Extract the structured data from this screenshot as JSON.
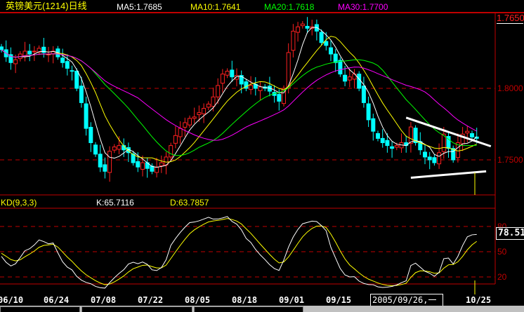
{
  "header": {
    "title": "英镑美元(1214)日线",
    "ma5": "MA5:1.7685",
    "ma10": "MA10:1.7641",
    "ma20": "MA20:1.7618",
    "ma30": "MA30:1.7700"
  },
  "price_axis": {
    "labels": [
      "1.8000",
      "1.7500"
    ],
    "cursor_value": "1.7650"
  },
  "kd": {
    "title": "KD(9,3,3)",
    "k": "K:65.7116",
    "d": "D:63.7857",
    "axis_labels": [
      "80",
      "50",
      "20"
    ],
    "cursor_value": "78.512"
  },
  "date_axis": {
    "labels": [
      "06/10",
      "06/24",
      "07/08",
      "07/22",
      "08/05",
      "08/18",
      "09/01",
      "09/15",
      "10/25"
    ],
    "cursor_date": "2005/09/26,一"
  },
  "colors": {
    "up": "#ff2020",
    "down": "#00ffff",
    "ma5": "#ffffff",
    "ma10": "#ffff00",
    "ma20": "#00ff00",
    "ma30": "#ff00ff",
    "grid": "#c00000",
    "k": "#ffffff",
    "d": "#ffff00"
  },
  "chart_data": {
    "type": "candlestick",
    "closes": [
      1.827,
      1.822,
      1.818,
      1.82,
      1.824,
      1.826,
      1.824,
      1.826,
      1.828,
      1.825,
      1.824,
      1.826,
      1.822,
      1.818,
      1.814,
      1.812,
      1.8,
      1.79,
      1.772,
      1.762,
      1.754,
      1.745,
      1.742,
      1.756,
      1.759,
      1.76,
      1.757,
      1.755,
      1.748,
      1.745,
      1.748,
      1.744,
      1.742,
      1.745,
      1.748,
      1.752,
      1.76,
      1.767,
      1.772,
      1.776,
      1.779,
      1.78,
      1.783,
      1.786,
      1.789,
      1.794,
      1.802,
      1.81,
      1.812,
      1.808,
      1.809,
      1.803,
      1.8,
      1.802,
      1.8,
      1.801,
      1.8,
      1.798,
      1.795,
      1.791,
      1.8,
      1.825,
      1.84,
      1.843,
      1.845,
      1.842,
      1.843,
      1.84,
      1.832,
      1.83,
      1.824,
      1.818,
      1.81,
      1.805,
      1.808,
      1.81,
      1.8,
      1.79,
      1.778,
      1.77,
      1.765,
      1.762,
      1.76,
      1.758,
      1.76,
      1.762,
      1.76,
      1.773,
      1.762,
      1.757,
      1.752,
      1.75,
      1.748,
      1.755,
      1.768,
      1.758,
      1.75,
      1.762,
      1.768,
      1.77,
      1.766,
      1.765
    ],
    "ylim": [
      1.735,
      1.855
    ],
    "trendlines": [
      {
        "from": [
          86,
          1.7795
        ],
        "to": [
          104,
          1.7595
        ]
      },
      {
        "from": [
          87,
          1.7375
        ],
        "to": [
          103,
          1.742
        ]
      }
    ]
  }
}
